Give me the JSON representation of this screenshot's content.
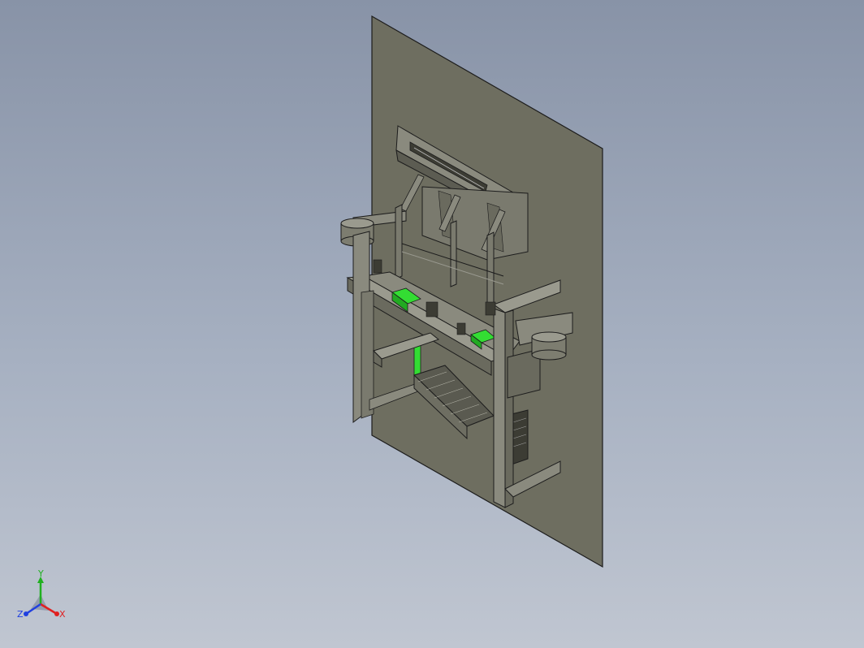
{
  "viewport": {
    "background_top": "#8893a7",
    "background_bottom": "#c0c6d1"
  },
  "model": {
    "plate_color": "#6e6e60",
    "body_color": "#7d7d70",
    "edge_color": "#1c1c1c",
    "highlight_color": "#33dd33"
  },
  "triad": {
    "icon": "view-orientation-triad-icon",
    "x_label": "X",
    "y_label": "Y",
    "z_label": "Z",
    "x_color": "#e02020",
    "y_color": "#20b020",
    "z_color": "#2040e0"
  }
}
